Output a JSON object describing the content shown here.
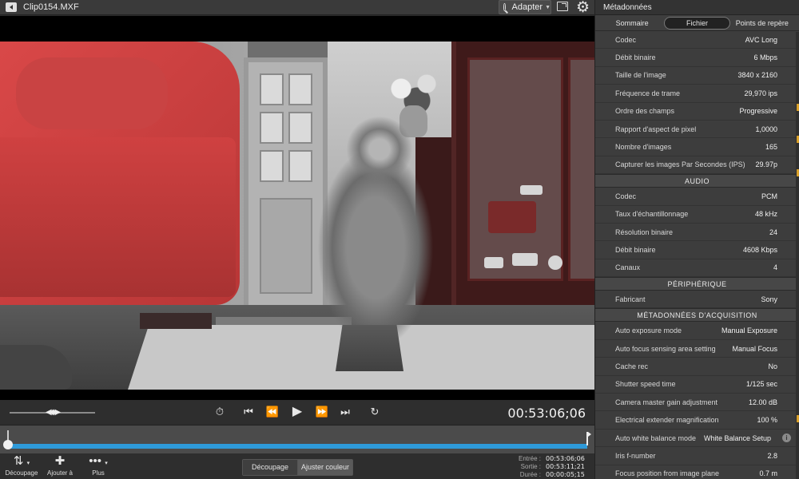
{
  "window": {
    "file_title": "Clip0154.MXF"
  },
  "viewer_toolbar": {
    "fit_label": "Adapter",
    "icons": [
      "back-icon",
      "search-icon",
      "chevron-down-icon",
      "fullscreen-icon",
      "gear-icon"
    ]
  },
  "transport": {
    "timecode": "00:53:06;06",
    "icons": [
      "jog-shuttle-icon",
      "timer-icon",
      "skip-start-icon",
      "step-back-icon",
      "play-icon",
      "step-forward-icon",
      "skip-end-icon",
      "loop-icon"
    ]
  },
  "timeline": {
    "progress": 0.0
  },
  "bottom_toolbar": {
    "decoupage_tool": "Découpage",
    "add_tool": "Ajouter à",
    "more_tool": "Plus",
    "mode_decoupage": "Découpage",
    "mode_couleur": "Ajuster couleur",
    "in_label": "Entrée :",
    "in_value": "00:53:06;06",
    "out_label": "Sortie :",
    "out_value": "00:53:11;21",
    "duration_label": "Durée :",
    "duration_value": "00:00:05;15"
  },
  "panel": {
    "title": "Métadonnées",
    "tabs": [
      {
        "label": "Sommaire",
        "active": false
      },
      {
        "label": "Fichier",
        "active": true
      },
      {
        "label": "Points de repère",
        "active": false
      }
    ],
    "video_rows": [
      {
        "key": "Codec",
        "value": "AVC Long"
      },
      {
        "key": "Débit binaire",
        "value": "6 Mbps"
      },
      {
        "key": "Taille de l'image",
        "value": "3840 x 2160"
      },
      {
        "key": "Fréquence de trame",
        "value": "29,970 ips"
      },
      {
        "key": "Ordre des champs",
        "value": "Progressive"
      },
      {
        "key": "Rapport d'aspect de pixel",
        "value": "1,0000"
      },
      {
        "key": "Nombre d'images",
        "value": "165"
      },
      {
        "key": "Capturer les images Par Secondes (IPS)",
        "value": "29.97p"
      }
    ],
    "audio_head": "AUDIO",
    "audio_rows": [
      {
        "key": "Codec",
        "value": "PCM"
      },
      {
        "key": "Taux d'échantillonnage",
        "value": "48 kHz"
      },
      {
        "key": "Résolution binaire",
        "value": "24"
      },
      {
        "key": "Débit binaire",
        "value": "4608 Kbps"
      },
      {
        "key": "Canaux",
        "value": "4"
      }
    ],
    "device_head": "PÉRIPHÉRIQUE",
    "device_rows": [
      {
        "key": "Fabricant",
        "value": "Sony"
      }
    ],
    "acq_head": "MÉTADONNÉES D'ACQUISITION",
    "acq_rows": [
      {
        "key": "Auto exposure mode",
        "value": "Manual Exposure"
      },
      {
        "key": "Auto focus sensing area setting",
        "value": "Manual Focus"
      },
      {
        "key": "Cache rec",
        "value": "No"
      },
      {
        "key": "Shutter speed time",
        "value": "1/125 sec"
      },
      {
        "key": "Camera master gain adjustment",
        "value": "12.00 dB"
      },
      {
        "key": "Electrical extender magnification",
        "value": "100 %"
      },
      {
        "key": "Auto white balance mode",
        "value": "White Balance Setup"
      },
      {
        "key": "Iris f-number",
        "value": "2.8"
      },
      {
        "key": "Focus position from image plane",
        "value": "0.7 m"
      }
    ]
  }
}
